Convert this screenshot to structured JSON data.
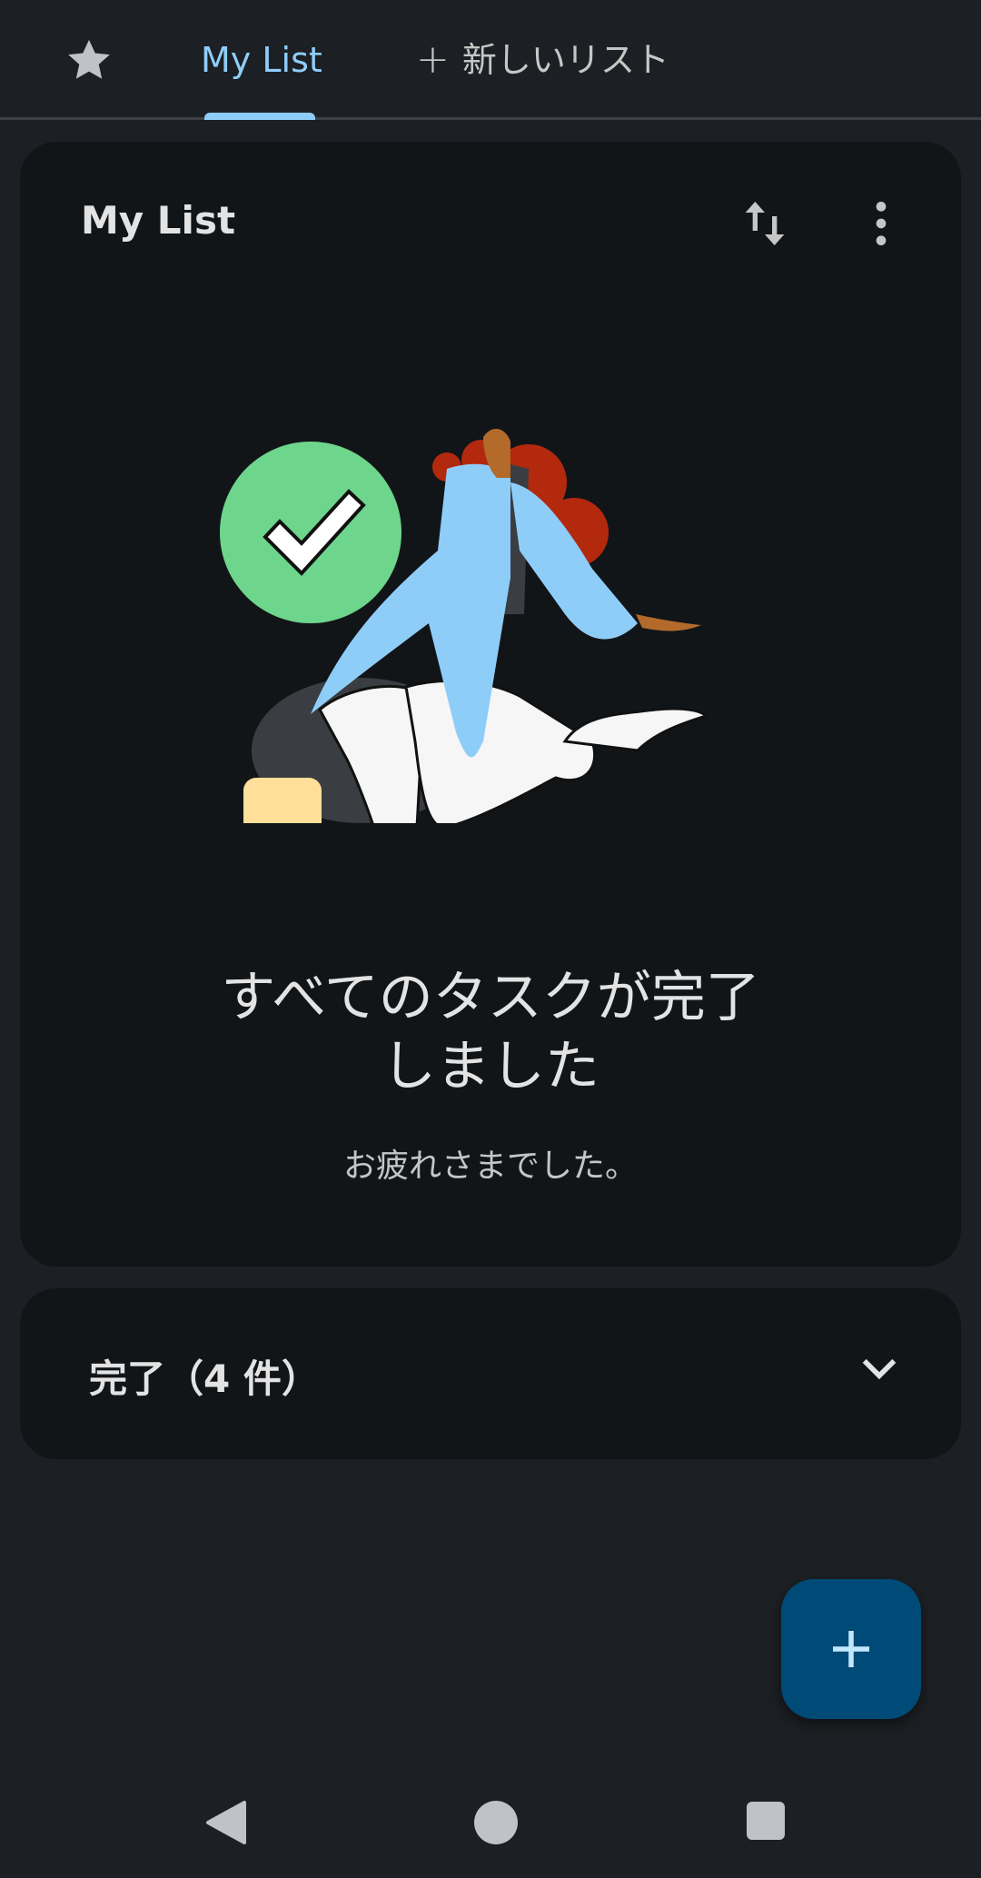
{
  "tabs": {
    "starred_icon": "star-icon",
    "items": [
      {
        "label": "My List",
        "selected": true
      },
      {
        "label": "新しいリスト",
        "icon": "plus-icon"
      }
    ],
    "new_list_plus": "+"
  },
  "list_card": {
    "title": "My List",
    "sort_icon": "swap-vert-icon",
    "menu_icon": "more-vert-icon",
    "empty_title_line1": "すべてのタスクが完了",
    "empty_title_line2": "しました",
    "empty_subtitle": "お疲れさまでした。"
  },
  "completed_section": {
    "label": "完了（4 件）",
    "icon": "chevron-down-icon"
  },
  "fab": {
    "label": "+",
    "icon": "plus-icon"
  },
  "nav": {
    "back": "back-icon",
    "home": "home-icon",
    "recents": "recents-icon"
  },
  "colors": {
    "background": "#1c1f23",
    "card": "#121518",
    "accent": "#8fcdf9",
    "fab": "#004a77",
    "check_circle": "#6dd58c",
    "hair": "#b3290e",
    "jacket": "#8fcdf9",
    "square": "#ffdf99"
  }
}
